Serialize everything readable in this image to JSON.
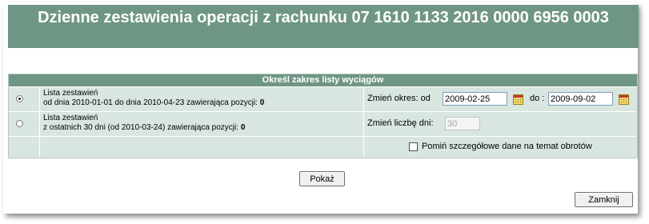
{
  "header": {
    "title": "Dzienne zestawienia operacji z rachunku 07 1610 1133 2016 0000 6956 0003"
  },
  "panel": {
    "title": "Określ zakres listy wyciągów"
  },
  "option1": {
    "selected": true,
    "line1": "Lista zestawień",
    "line2": "od dnia 2010-01-01 do dnia 2010-04-23 zawierająca pozycji: ",
    "count": "0",
    "range_label": "Zmień okres: od",
    "from_value": "2009-02-25",
    "to_label": "do :",
    "to_value": "2009-09-02"
  },
  "option2": {
    "selected": false,
    "line1": "Lista zestawień",
    "line2": "z ostatnich 30 dni (od 2010-03-24) zawierająca pozycji: ",
    "count": "0",
    "days_label": "Zmień liczbę dni:",
    "days_value": "30"
  },
  "skip_details": {
    "checked": false,
    "label": "Pomiń szczegółowe dane na temat obrotów"
  },
  "buttons": {
    "show": "Pokaż",
    "close": "Zamknij"
  },
  "icons": {
    "calendar": "calendar-icon"
  },
  "colors": {
    "header_bg": "#6f9684",
    "panel_bg": "#d9e6df"
  }
}
